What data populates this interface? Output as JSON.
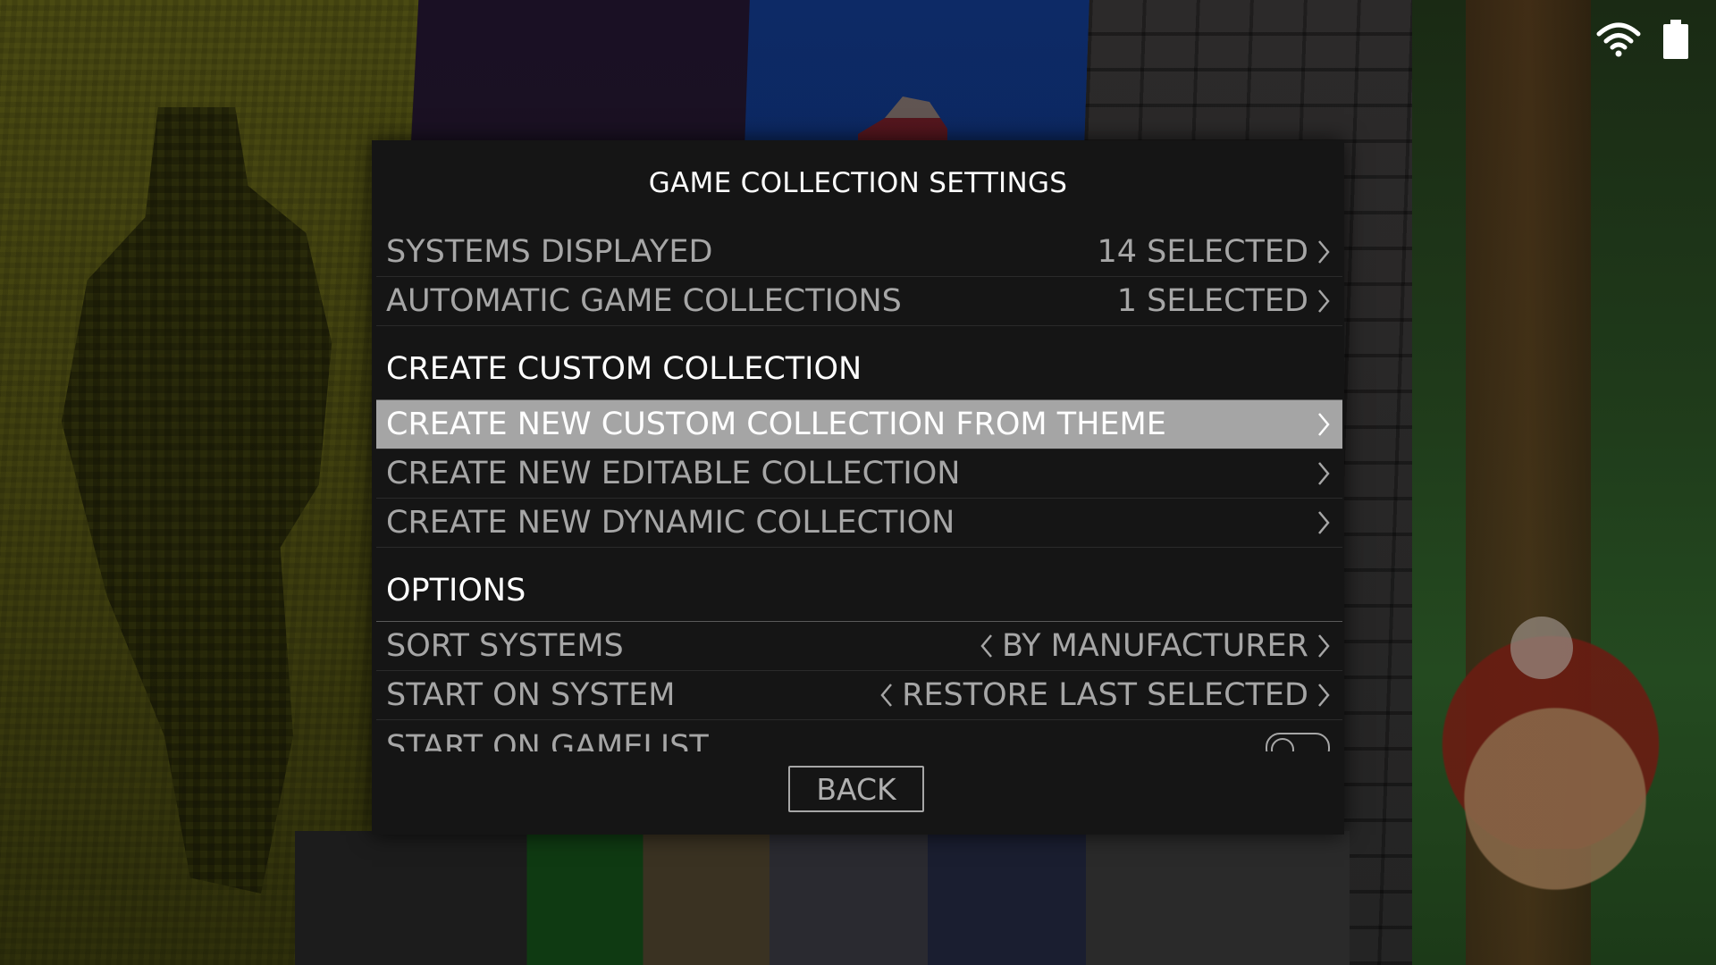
{
  "dialog": {
    "title": "GAME COLLECTION SETTINGS",
    "back_label": "BACK"
  },
  "menu": {
    "systems_displayed": {
      "label": "SYSTEMS DISPLAYED",
      "value": "14 SELECTED"
    },
    "automatic_collections": {
      "label": "AUTOMATIC GAME COLLECTIONS",
      "value": "1 SELECTED"
    },
    "section_custom": "CREATE CUSTOM COLLECTION",
    "create_from_theme": {
      "label": "CREATE NEW CUSTOM COLLECTION FROM THEME"
    },
    "create_editable": {
      "label": "CREATE NEW EDITABLE COLLECTION"
    },
    "create_dynamic": {
      "label": "CREATE NEW DYNAMIC COLLECTION"
    },
    "section_options": "OPTIONS",
    "sort_systems": {
      "label": "SORT SYSTEMS",
      "value": "BY MANUFACTURER"
    },
    "start_on_system": {
      "label": "START ON SYSTEM",
      "value": "RESTORE LAST SELECTED"
    },
    "start_on_gamelist": {
      "label": "START ON GAMELIST",
      "toggle": "off"
    }
  },
  "status": {
    "icons": [
      "wifi-icon",
      "battery-icon"
    ]
  },
  "colors": {
    "dialog_bg": "#151515",
    "highlight_bg": "#a5a5a5",
    "text_dim": "#a6a6a6",
    "text_bright": "#ffffff"
  }
}
